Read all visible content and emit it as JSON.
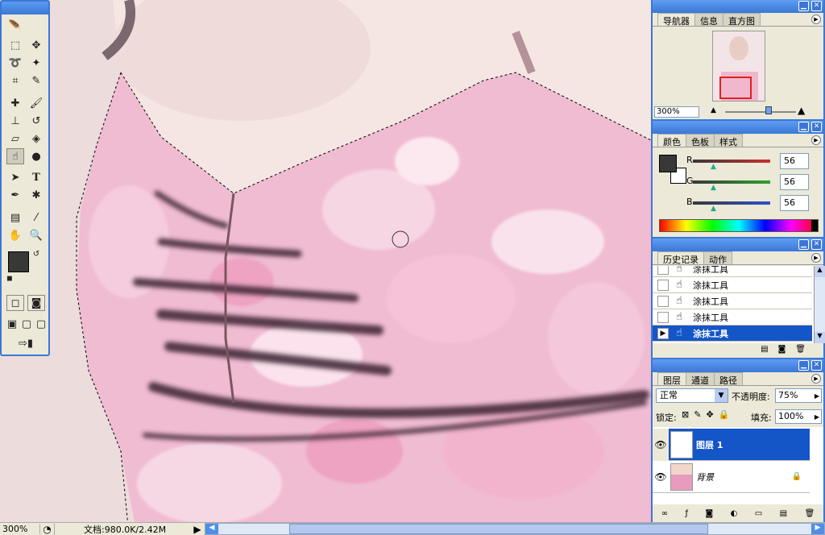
{
  "navigator": {
    "tabs": [
      "导航器",
      "信息",
      "直方图"
    ],
    "zoom": "300%"
  },
  "color": {
    "tabs": [
      "颜色",
      "色板",
      "样式"
    ],
    "channels": [
      {
        "label": "R",
        "value": "56"
      },
      {
        "label": "G",
        "value": "56"
      },
      {
        "label": "B",
        "value": "56"
      }
    ],
    "channel_colors": [
      "#c83030",
      "#30a030",
      "#3050c8"
    ]
  },
  "history": {
    "tabs": [
      "历史记录",
      "动作"
    ],
    "items": [
      "涂抹工具",
      "涂抹工具",
      "涂抹工具",
      "涂抹工具",
      "涂抹工具"
    ],
    "selected_index": 4
  },
  "layers": {
    "tabs": [
      "图层",
      "通道",
      "路径"
    ],
    "blend_mode": "正常",
    "opacity_label": "不透明度:",
    "opacity": "75%",
    "lock_label": "锁定:",
    "fill_label": "填充:",
    "fill": "100%",
    "items": [
      {
        "name": "图层 1",
        "selected": true
      },
      {
        "name": "背景",
        "selected": false
      }
    ]
  },
  "status": {
    "zoom": "300%",
    "doc_info": "文档:980.0K/2.42M"
  },
  "colors": {
    "accent": "#3a78d6",
    "selection": "#1456c8",
    "foreground": "#383838"
  }
}
